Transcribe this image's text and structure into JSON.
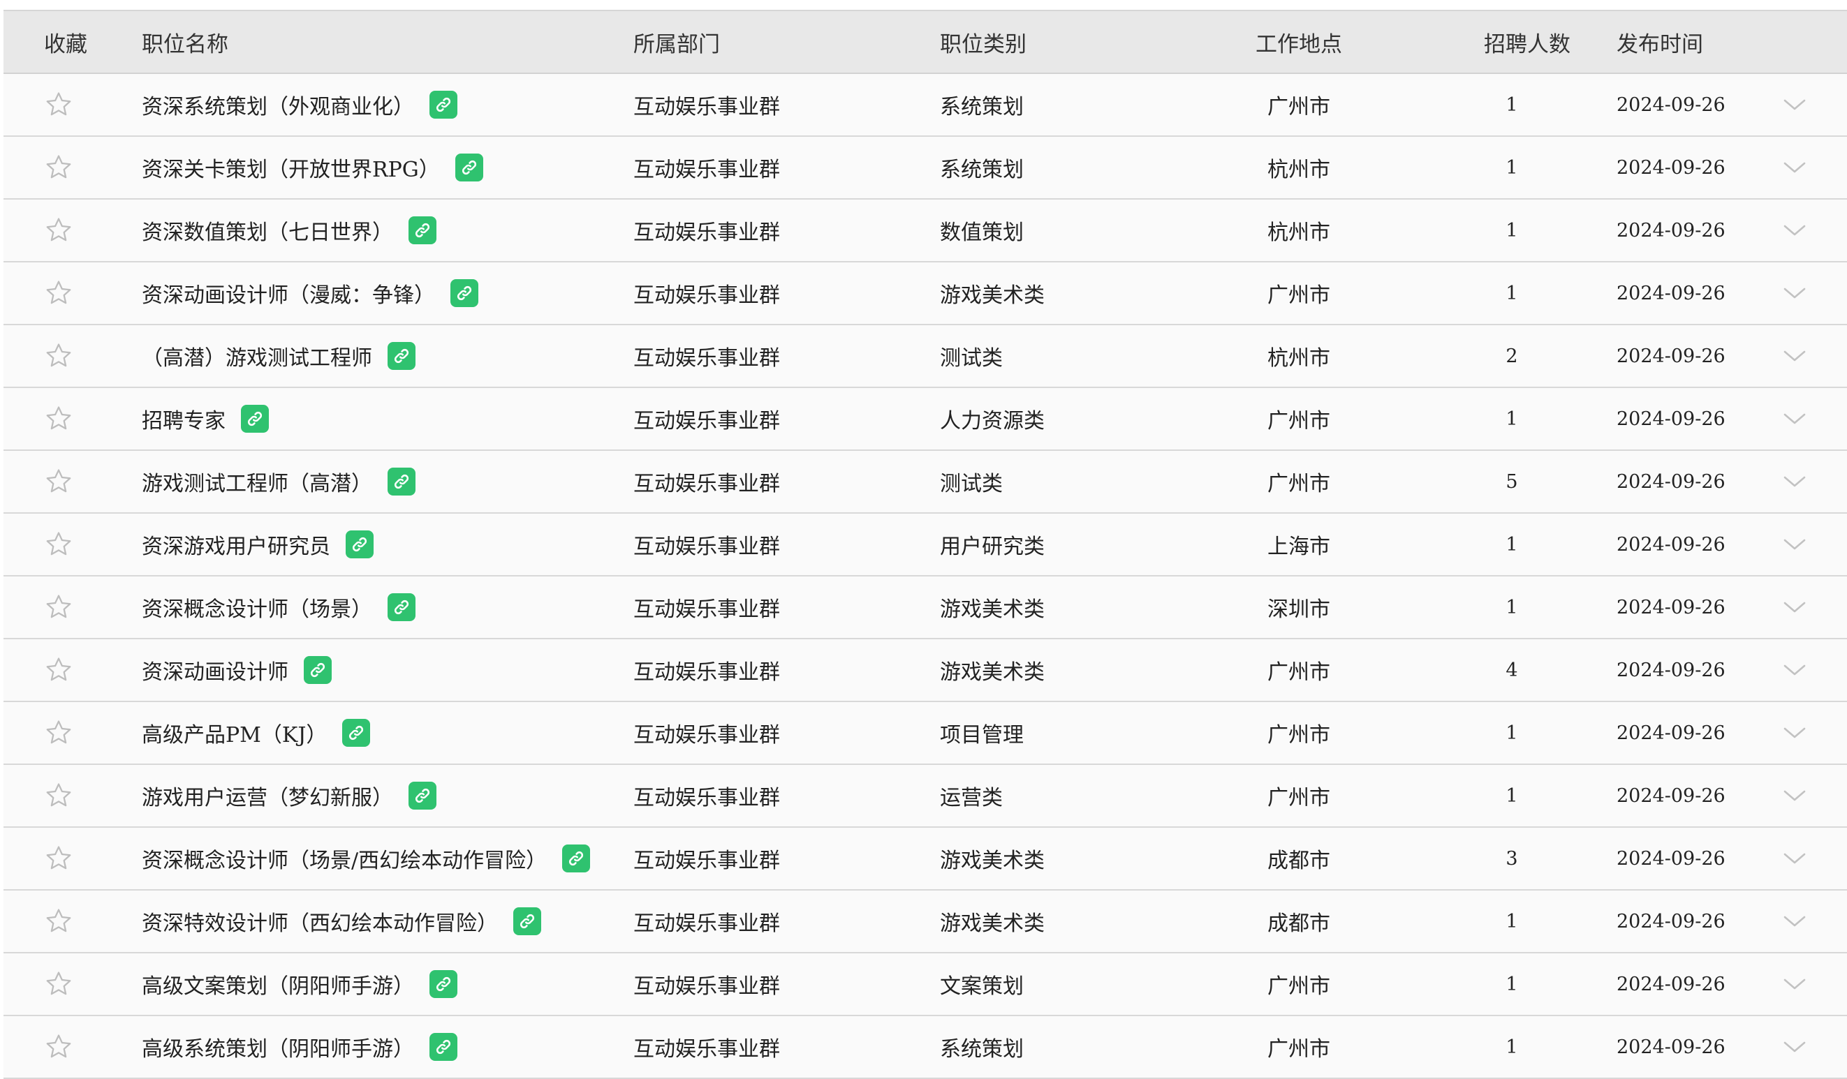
{
  "table": {
    "headers": {
      "favorite": "收藏",
      "name": "职位名称",
      "department": "所属部门",
      "category": "职位类别",
      "location": "工作地点",
      "headcount": "招聘人数",
      "date": "发布时间"
    },
    "icons": {
      "favorite": "star-outline-icon",
      "link": "link-icon",
      "expand": "chevron-down-icon"
    },
    "colors": {
      "link_badge": "#2fc26f",
      "header_bg": "#e8e8e8",
      "row_bg": "#fafafa"
    },
    "rows": [
      {
        "name": "资深系统策划（外观商业化）",
        "department": "互动娱乐事业群",
        "category": "系统策划",
        "location": "广州市",
        "headcount": "1",
        "date": "2024-09-26"
      },
      {
        "name": "资深关卡策划（开放世界RPG）",
        "department": "互动娱乐事业群",
        "category": "系统策划",
        "location": "杭州市",
        "headcount": "1",
        "date": "2024-09-26"
      },
      {
        "name": "资深数值策划（七日世界）",
        "department": "互动娱乐事业群",
        "category": "数值策划",
        "location": "杭州市",
        "headcount": "1",
        "date": "2024-09-26"
      },
      {
        "name": "资深动画设计师（漫威：争锋）",
        "department": "互动娱乐事业群",
        "category": "游戏美术类",
        "location": "广州市",
        "headcount": "1",
        "date": "2024-09-26"
      },
      {
        "name": "（高潜）游戏测试工程师",
        "department": "互动娱乐事业群",
        "category": "测试类",
        "location": "杭州市",
        "headcount": "2",
        "date": "2024-09-26"
      },
      {
        "name": "招聘专家",
        "department": "互动娱乐事业群",
        "category": "人力资源类",
        "location": "广州市",
        "headcount": "1",
        "date": "2024-09-26"
      },
      {
        "name": "游戏测试工程师（高潜）",
        "department": "互动娱乐事业群",
        "category": "测试类",
        "location": "广州市",
        "headcount": "5",
        "date": "2024-09-26"
      },
      {
        "name": "资深游戏用户研究员",
        "department": "互动娱乐事业群",
        "category": "用户研究类",
        "location": "上海市",
        "headcount": "1",
        "date": "2024-09-26"
      },
      {
        "name": "资深概念设计师（场景）",
        "department": "互动娱乐事业群",
        "category": "游戏美术类",
        "location": "深圳市",
        "headcount": "1",
        "date": "2024-09-26"
      },
      {
        "name": "资深动画设计师",
        "department": "互动娱乐事业群",
        "category": "游戏美术类",
        "location": "广州市",
        "headcount": "4",
        "date": "2024-09-26"
      },
      {
        "name": "高级产品PM（KJ）",
        "department": "互动娱乐事业群",
        "category": "项目管理",
        "location": "广州市",
        "headcount": "1",
        "date": "2024-09-26"
      },
      {
        "name": "游戏用户运营（梦幻新服）",
        "department": "互动娱乐事业群",
        "category": "运营类",
        "location": "广州市",
        "headcount": "1",
        "date": "2024-09-26"
      },
      {
        "name": "资深概念设计师（场景/西幻绘本动作冒险）",
        "department": "互动娱乐事业群",
        "category": "游戏美术类",
        "location": "成都市",
        "headcount": "3",
        "date": "2024-09-26"
      },
      {
        "name": "资深特效设计师（西幻绘本动作冒险）",
        "department": "互动娱乐事业群",
        "category": "游戏美术类",
        "location": "成都市",
        "headcount": "1",
        "date": "2024-09-26"
      },
      {
        "name": "高级文案策划（阴阳师手游）",
        "department": "互动娱乐事业群",
        "category": "文案策划",
        "location": "广州市",
        "headcount": "1",
        "date": "2024-09-26"
      },
      {
        "name": "高级系统策划（阴阳师手游）",
        "department": "互动娱乐事业群",
        "category": "系统策划",
        "location": "广州市",
        "headcount": "1",
        "date": "2024-09-26"
      }
    ]
  }
}
